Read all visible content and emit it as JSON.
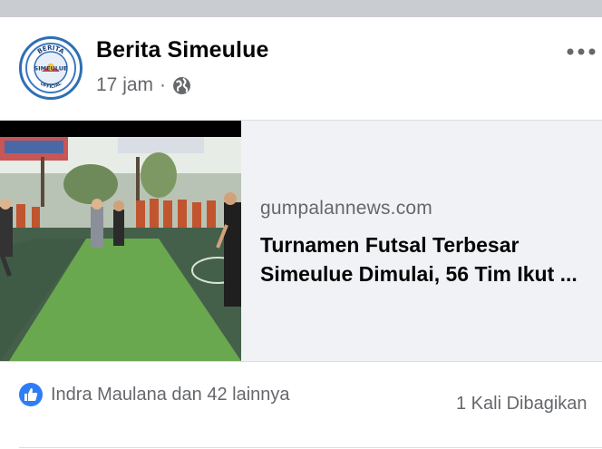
{
  "post": {
    "author": "Berita Simeulue",
    "time": "17 jam",
    "separator": "·",
    "avatar_text": {
      "top": "BERITA",
      "middle": "SIMEULUE",
      "bottom": "OFFICIAL"
    },
    "privacy_icon": "globe-icon",
    "menu_icon": "more-options-icon"
  },
  "link": {
    "domain": "gumpalannews.com",
    "title_line1": "Turnamen Futsal Terbesar",
    "title_line2": "Simeulue Dimulai, 56 Tim Ikut ..."
  },
  "reactions": {
    "text": "Indra Maulana dan 42 lainnya",
    "shares": "1 Kali Dibagikan",
    "icon": "like-icon"
  },
  "colors": {
    "accent": "#2e7df6",
    "text_primary": "#050505",
    "text_secondary": "#65676b",
    "card_bg": "#f0f2f5",
    "top_bar": "#c9ccd1"
  }
}
